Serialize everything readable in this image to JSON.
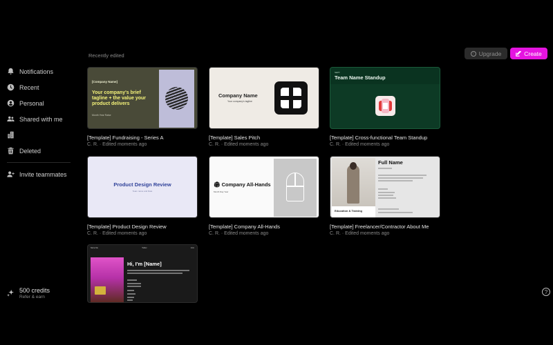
{
  "sidebar": {
    "items": [
      {
        "label": "Notifications",
        "icon": "bell-icon"
      },
      {
        "label": "Recent",
        "icon": "clock-icon"
      },
      {
        "label": "Personal",
        "icon": "user-icon"
      },
      {
        "label": "Shared with me",
        "icon": "users-icon"
      },
      {
        "label": "",
        "icon": "building-icon"
      },
      {
        "label": "Deleted",
        "icon": "trash-icon"
      }
    ],
    "invite": {
      "label": "Invite teammates",
      "icon": "user-plus-icon"
    },
    "credits": {
      "amount_label": "500 credits",
      "sub_label": "Refer & earn",
      "icon": "sparkle-icon"
    }
  },
  "header": {
    "section_title": "Recently edited",
    "upgrade_label": "Upgrade",
    "create_label": "Create"
  },
  "help_icon": "?",
  "cards": [
    {
      "title": "[Template] Fundraising - Series A",
      "meta": "C. R. · Edited moments ago",
      "preview": {
        "label": "[Company Name]",
        "headline": "Your company's brief tagline + the value your product delivers",
        "small": "Month Year Raise"
      }
    },
    {
      "title": "[Template] Sales Pitch",
      "meta": "C. R. · Edited moments ago",
      "preview": {
        "name": "Company Name",
        "sub": "Your company's tagline"
      }
    },
    {
      "title": "[Template] Cross-functional Team Standup",
      "meta": "C. R. · Edited moments ago",
      "preview": {
        "tiny": "SEPT",
        "name": "Team Name Standup"
      }
    },
    {
      "title": "[Template] Product Design Review",
      "meta": "C. R. · Edited moments ago",
      "preview": {
        "name": "Product Design Review",
        "sub": "Team name and Date"
      }
    },
    {
      "title": "[Template] Company All-Hands",
      "meta": "C. R. · Edited moments ago",
      "preview": {
        "name": "🏟 Company All-Hands",
        "sub": "Month Day Year"
      }
    },
    {
      "title": "[Template] Freelancer/Contractor About Me",
      "meta": "C. R. · Edited moments ago",
      "preview": {
        "name": "Full Name",
        "edu": "Education & Training"
      }
    },
    {
      "title": "",
      "meta": "",
      "preview": {
        "nav_left": "Name Me",
        "nav_mid": "Twitter",
        "nav_right": "Intro",
        "name": "Hi, I'm [Name]"
      }
    }
  ],
  "colors": {
    "background": "#000000",
    "create_button": "#e514e0",
    "upgrade_button": "#2b2b2b"
  }
}
